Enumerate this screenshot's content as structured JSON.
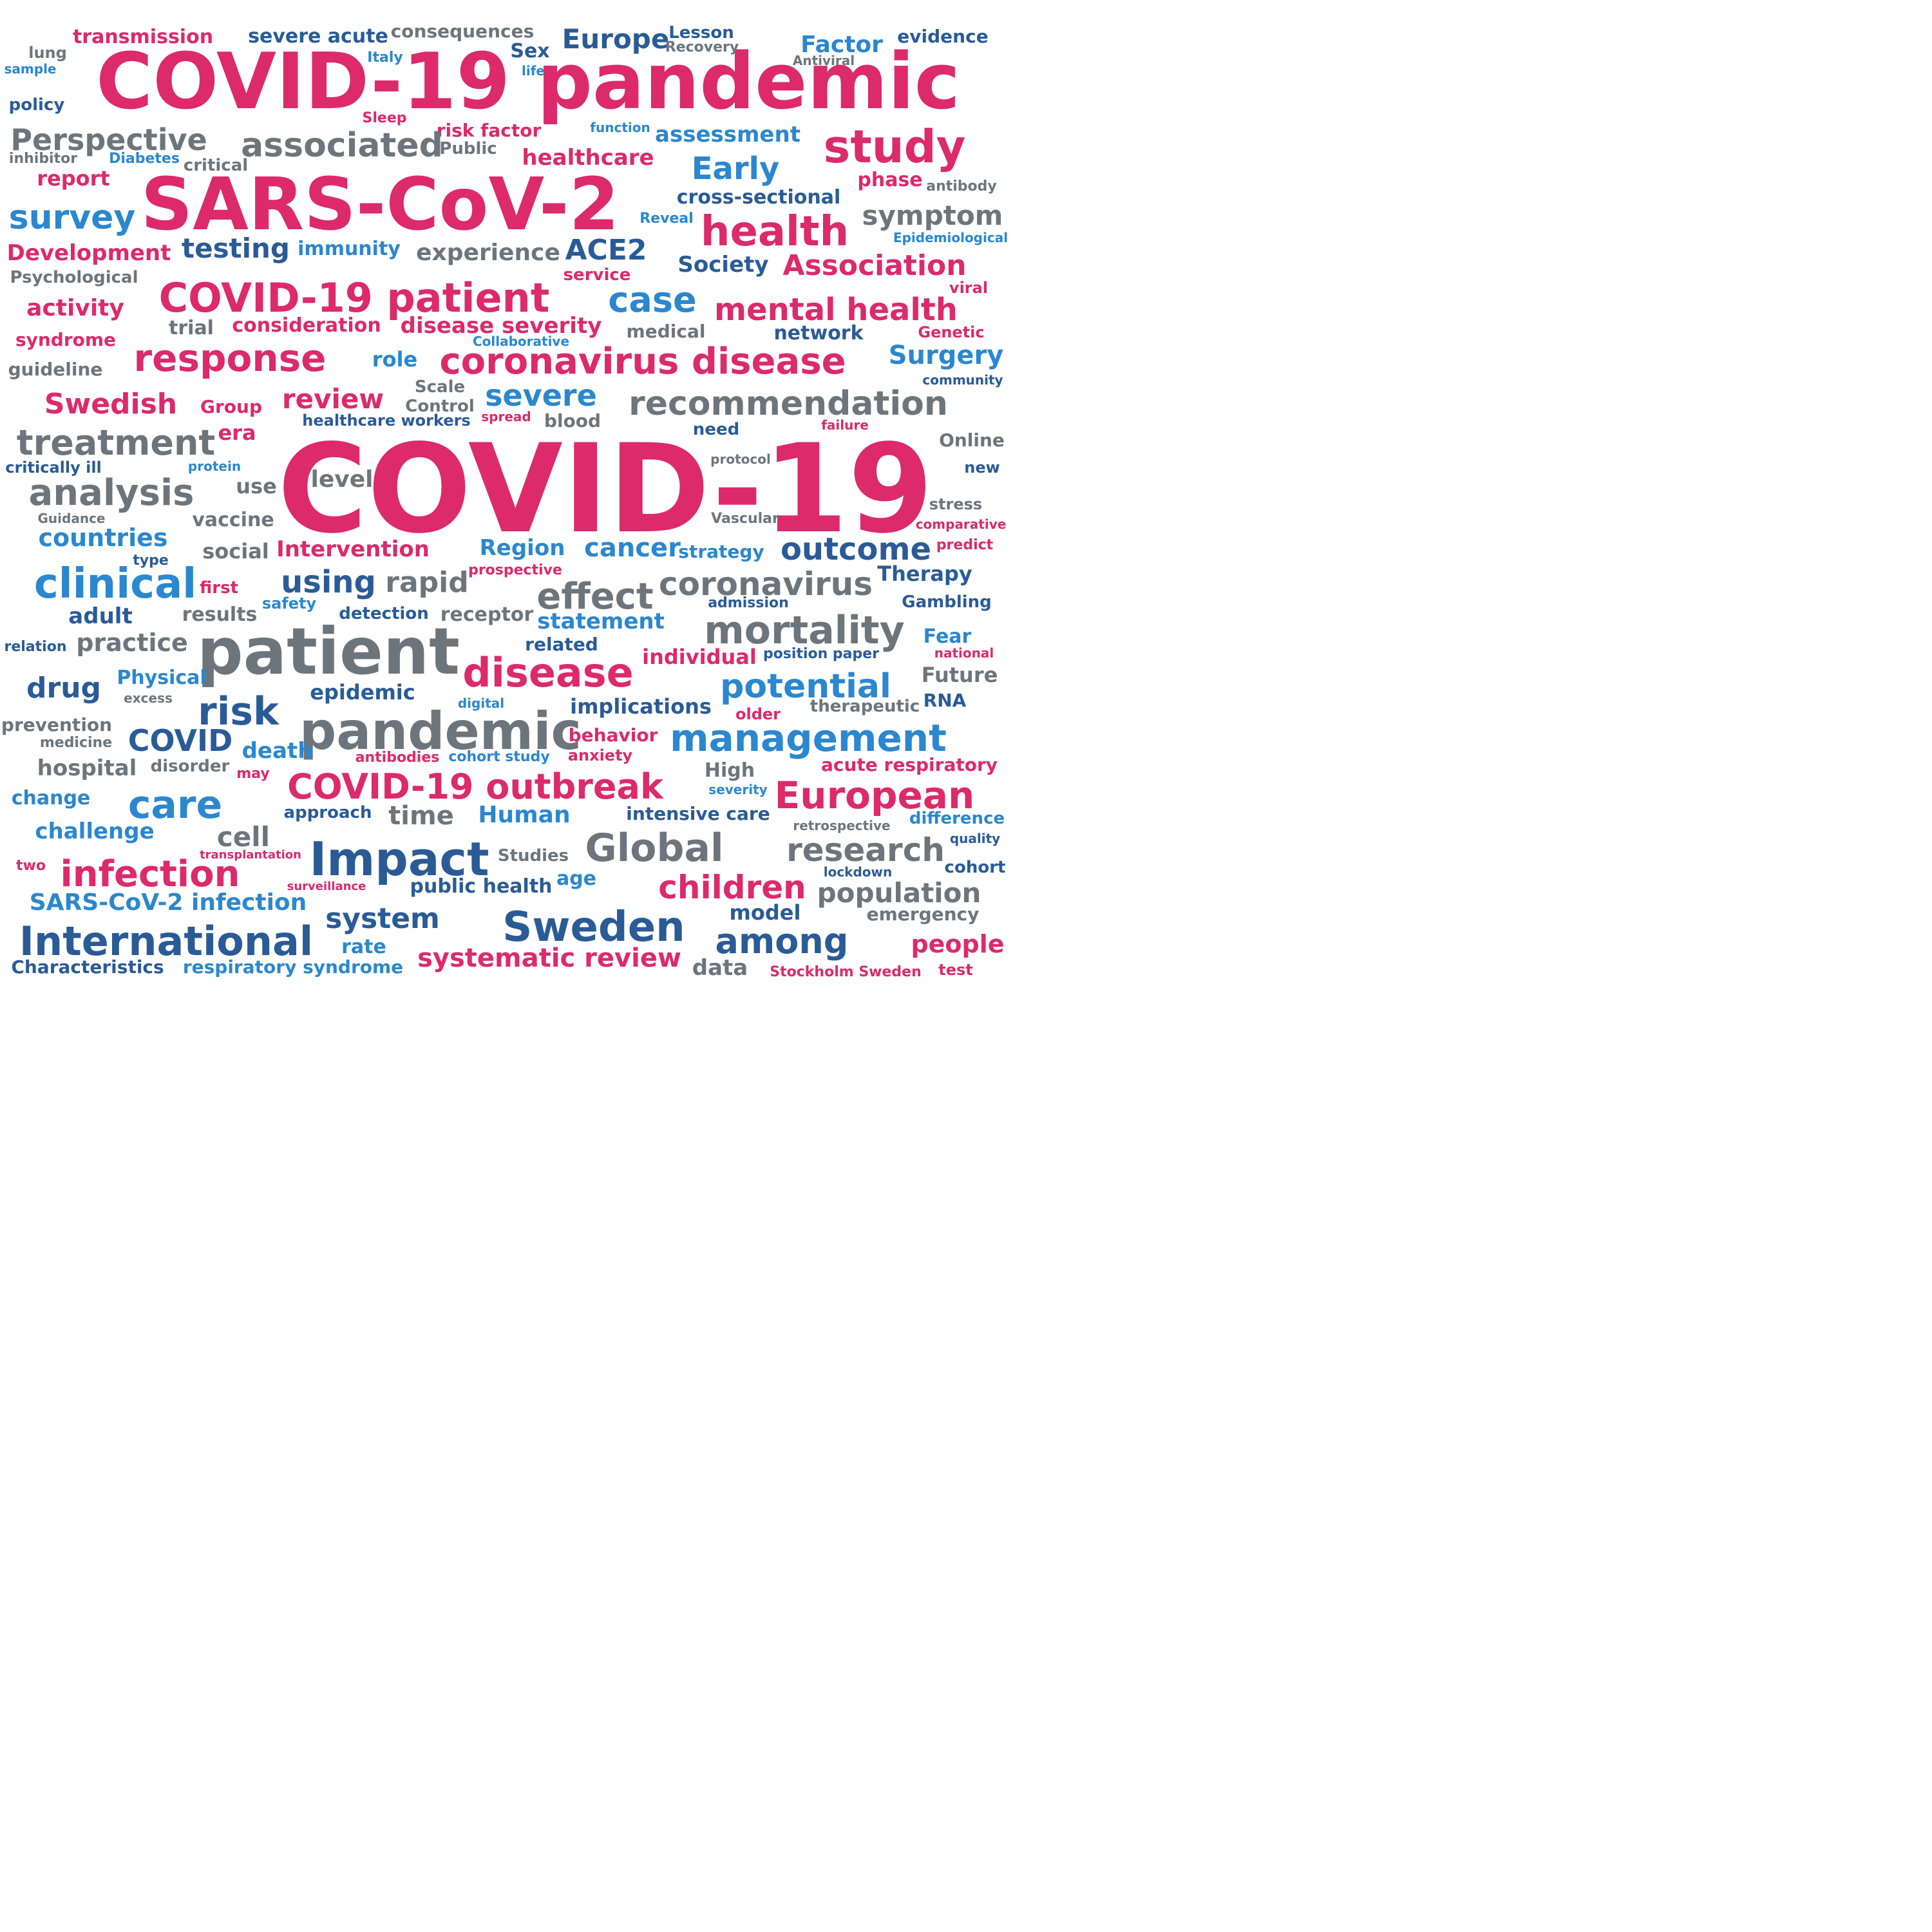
{
  "colors": {
    "pink": "#dc2a6b",
    "blue": "#2b87cf",
    "navy": "#2a5b97",
    "gray": "#6d757c"
  },
  "words": [
    {
      "text": "COVID-19 pandemic",
      "color": "pink"
    },
    {
      "text": "COVID-19",
      "color": "pink"
    },
    {
      "text": "SARS-CoV-2",
      "color": "pink"
    },
    {
      "text": "transmission",
      "color": "pink"
    },
    {
      "text": "severe acute",
      "color": "navy"
    },
    {
      "text": "consequences",
      "color": "gray"
    },
    {
      "text": "Europe",
      "color": "navy"
    },
    {
      "text": "Lesson",
      "color": "navy"
    },
    {
      "text": "Recovery",
      "color": "gray"
    },
    {
      "text": "Factor",
      "color": "blue"
    },
    {
      "text": "evidence",
      "color": "navy"
    },
    {
      "text": "lung",
      "color": "gray"
    },
    {
      "text": "sample",
      "color": "blue"
    },
    {
      "text": "Italy",
      "color": "blue"
    },
    {
      "text": "Sex",
      "color": "navy"
    },
    {
      "text": "life",
      "color": "blue"
    },
    {
      "text": "Antiviral",
      "color": "gray"
    },
    {
      "text": "policy",
      "color": "navy"
    },
    {
      "text": "Sleep",
      "color": "pink"
    },
    {
      "text": "risk factor",
      "color": "pink"
    },
    {
      "text": "function",
      "color": "blue"
    },
    {
      "text": "Perspective",
      "color": "gray"
    },
    {
      "text": "associated",
      "color": "gray"
    },
    {
      "text": "assessment",
      "color": "blue"
    },
    {
      "text": "study",
      "color": "pink"
    },
    {
      "text": "inhibitor",
      "color": "gray"
    },
    {
      "text": "Diabetes",
      "color": "blue"
    },
    {
      "text": "critical",
      "color": "gray"
    },
    {
      "text": "Public",
      "color": "gray"
    },
    {
      "text": "healthcare",
      "color": "pink"
    },
    {
      "text": "Early",
      "color": "blue"
    },
    {
      "text": "report",
      "color": "pink"
    },
    {
      "text": "phase",
      "color": "pink"
    },
    {
      "text": "antibody",
      "color": "gray"
    },
    {
      "text": "cross-sectional",
      "color": "navy"
    },
    {
      "text": "survey",
      "color": "blue"
    },
    {
      "text": "Reveal",
      "color": "blue"
    },
    {
      "text": "symptom",
      "color": "gray"
    },
    {
      "text": "health",
      "color": "pink"
    },
    {
      "text": "Epidemiological",
      "color": "blue"
    },
    {
      "text": "Development",
      "color": "pink"
    },
    {
      "text": "testing",
      "color": "navy"
    },
    {
      "text": "immunity",
      "color": "blue"
    },
    {
      "text": "experience",
      "color": "gray"
    },
    {
      "text": "ACE2",
      "color": "navy"
    },
    {
      "text": "Society",
      "color": "navy"
    },
    {
      "text": "Association",
      "color": "pink"
    },
    {
      "text": "Psychological",
      "color": "gray"
    },
    {
      "text": "service",
      "color": "pink"
    },
    {
      "text": "viral",
      "color": "pink"
    },
    {
      "text": "activity",
      "color": "pink"
    },
    {
      "text": "COVID-19 patient",
      "color": "pink"
    },
    {
      "text": "case",
      "color": "blue"
    },
    {
      "text": "mental health",
      "color": "pink"
    },
    {
      "text": "trial",
      "color": "gray"
    },
    {
      "text": "consideration",
      "color": "pink"
    },
    {
      "text": "disease severity",
      "color": "pink"
    },
    {
      "text": "medical",
      "color": "gray"
    },
    {
      "text": "network",
      "color": "navy"
    },
    {
      "text": "Genetic",
      "color": "pink"
    },
    {
      "text": "syndrome",
      "color": "pink"
    },
    {
      "text": "Collaborative",
      "color": "blue"
    },
    {
      "text": "response",
      "color": "pink"
    },
    {
      "text": "role",
      "color": "blue"
    },
    {
      "text": "coronavirus disease",
      "color": "pink"
    },
    {
      "text": "Surgery",
      "color": "blue"
    },
    {
      "text": "guideline",
      "color": "gray"
    },
    {
      "text": "community",
      "color": "navy"
    },
    {
      "text": "Scale",
      "color": "gray"
    },
    {
      "text": "Swedish",
      "color": "pink"
    },
    {
      "text": "Group",
      "color": "pink"
    },
    {
      "text": "review",
      "color": "pink"
    },
    {
      "text": "Control",
      "color": "gray"
    },
    {
      "text": "severe",
      "color": "blue"
    },
    {
      "text": "recommendation",
      "color": "gray"
    },
    {
      "text": "healthcare workers",
      "color": "navy"
    },
    {
      "text": "spread",
      "color": "pink"
    },
    {
      "text": "blood",
      "color": "gray"
    },
    {
      "text": "need",
      "color": "navy"
    },
    {
      "text": "failure",
      "color": "pink"
    },
    {
      "text": "treatment",
      "color": "gray"
    },
    {
      "text": "era",
      "color": "pink"
    },
    {
      "text": "Online",
      "color": "gray"
    },
    {
      "text": "critically ill",
      "color": "navy"
    },
    {
      "text": "protein",
      "color": "blue"
    },
    {
      "text": "protocol",
      "color": "gray"
    },
    {
      "text": "new",
      "color": "navy"
    },
    {
      "text": "analysis",
      "color": "gray"
    },
    {
      "text": "use",
      "color": "gray"
    },
    {
      "text": "level",
      "color": "gray"
    },
    {
      "text": "stress",
      "color": "gray"
    },
    {
      "text": "Guidance",
      "color": "gray"
    },
    {
      "text": "vaccine",
      "color": "gray"
    },
    {
      "text": "Vascular",
      "color": "gray"
    },
    {
      "text": "comparative",
      "color": "pink"
    },
    {
      "text": "countries",
      "color": "blue"
    },
    {
      "text": "social",
      "color": "gray"
    },
    {
      "text": "Intervention",
      "color": "pink"
    },
    {
      "text": "Region",
      "color": "blue"
    },
    {
      "text": "cancer",
      "color": "blue"
    },
    {
      "text": "strategy",
      "color": "blue"
    },
    {
      "text": "outcome",
      "color": "navy"
    },
    {
      "text": "predict",
      "color": "pink"
    },
    {
      "text": "type",
      "color": "navy"
    },
    {
      "text": "clinical",
      "color": "blue"
    },
    {
      "text": "prospective",
      "color": "pink"
    },
    {
      "text": "Therapy",
      "color": "navy"
    },
    {
      "text": "first",
      "color": "pink"
    },
    {
      "text": "using",
      "color": "navy"
    },
    {
      "text": "rapid",
      "color": "gray"
    },
    {
      "text": "effect",
      "color": "gray"
    },
    {
      "text": "coronavirus",
      "color": "gray"
    },
    {
      "text": "safety",
      "color": "blue"
    },
    {
      "text": "admission",
      "color": "navy"
    },
    {
      "text": "Gambling",
      "color": "navy"
    },
    {
      "text": "adult",
      "color": "navy"
    },
    {
      "text": "results",
      "color": "gray"
    },
    {
      "text": "detection",
      "color": "navy"
    },
    {
      "text": "receptor",
      "color": "gray"
    },
    {
      "text": "statement",
      "color": "blue"
    },
    {
      "text": "mortality",
      "color": "gray"
    },
    {
      "text": "relation",
      "color": "navy"
    },
    {
      "text": "practice",
      "color": "gray"
    },
    {
      "text": "patient",
      "color": "gray"
    },
    {
      "text": "related",
      "color": "navy"
    },
    {
      "text": "Fear",
      "color": "blue"
    },
    {
      "text": "individual",
      "color": "pink"
    },
    {
      "text": "position paper",
      "color": "navy"
    },
    {
      "text": "national",
      "color": "pink"
    },
    {
      "text": "disease",
      "color": "pink"
    },
    {
      "text": "drug",
      "color": "navy"
    },
    {
      "text": "Physical",
      "color": "blue"
    },
    {
      "text": "potential",
      "color": "blue"
    },
    {
      "text": "Future",
      "color": "gray"
    },
    {
      "text": "excess",
      "color": "gray"
    },
    {
      "text": "epidemic",
      "color": "navy"
    },
    {
      "text": "digital",
      "color": "blue"
    },
    {
      "text": "implications",
      "color": "navy"
    },
    {
      "text": "therapeutic",
      "color": "gray"
    },
    {
      "text": "RNA",
      "color": "navy"
    },
    {
      "text": "risk",
      "color": "navy"
    },
    {
      "text": "older",
      "color": "pink"
    },
    {
      "text": "prevention",
      "color": "gray"
    },
    {
      "text": "medicine",
      "color": "gray"
    },
    {
      "text": "COVID",
      "color": "navy"
    },
    {
      "text": "pandemic",
      "color": "gray"
    },
    {
      "text": "behavior",
      "color": "pink"
    },
    {
      "text": "management",
      "color": "blue"
    },
    {
      "text": "death",
      "color": "blue"
    },
    {
      "text": "antibodies",
      "color": "pink"
    },
    {
      "text": "cohort study",
      "color": "blue"
    },
    {
      "text": "anxiety",
      "color": "pink"
    },
    {
      "text": "hospital",
      "color": "gray"
    },
    {
      "text": "disorder",
      "color": "gray"
    },
    {
      "text": "High",
      "color": "gray"
    },
    {
      "text": "acute respiratory",
      "color": "pink"
    },
    {
      "text": "may",
      "color": "pink"
    },
    {
      "text": "COVID-19 outbreak",
      "color": "pink"
    },
    {
      "text": "severity",
      "color": "blue"
    },
    {
      "text": "European",
      "color": "pink"
    },
    {
      "text": "change",
      "color": "blue"
    },
    {
      "text": "care",
      "color": "blue"
    },
    {
      "text": "approach",
      "color": "navy"
    },
    {
      "text": "time",
      "color": "gray"
    },
    {
      "text": "Human",
      "color": "blue"
    },
    {
      "text": "intensive care",
      "color": "navy"
    },
    {
      "text": "retrospective",
      "color": "gray"
    },
    {
      "text": "difference",
      "color": "blue"
    },
    {
      "text": "challenge",
      "color": "blue"
    },
    {
      "text": "cell",
      "color": "gray"
    },
    {
      "text": "Global",
      "color": "gray"
    },
    {
      "text": "quality",
      "color": "navy"
    },
    {
      "text": "Impact",
      "color": "navy"
    },
    {
      "text": "Studies",
      "color": "gray"
    },
    {
      "text": "research",
      "color": "gray"
    },
    {
      "text": "transplantation",
      "color": "pink"
    },
    {
      "text": "two",
      "color": "pink"
    },
    {
      "text": "infection",
      "color": "pink"
    },
    {
      "text": "cohort",
      "color": "navy"
    },
    {
      "text": "lockdown",
      "color": "navy"
    },
    {
      "text": "age",
      "color": "blue"
    },
    {
      "text": "surveillance",
      "color": "pink"
    },
    {
      "text": "public health",
      "color": "navy"
    },
    {
      "text": "children",
      "color": "pink"
    },
    {
      "text": "population",
      "color": "gray"
    },
    {
      "text": "SARS-CoV-2 infection",
      "color": "blue"
    },
    {
      "text": "model",
      "color": "navy"
    },
    {
      "text": "emergency",
      "color": "gray"
    },
    {
      "text": "system",
      "color": "navy"
    },
    {
      "text": "Sweden",
      "color": "navy"
    },
    {
      "text": "International",
      "color": "navy"
    },
    {
      "text": "among",
      "color": "navy"
    },
    {
      "text": "people",
      "color": "pink"
    },
    {
      "text": "rate",
      "color": "blue"
    },
    {
      "text": "systematic review",
      "color": "pink"
    },
    {
      "text": "Characteristics",
      "color": "navy"
    },
    {
      "text": "respiratory syndrome",
      "color": "blue"
    },
    {
      "text": "data",
      "color": "gray"
    },
    {
      "text": "Stockholm Sweden",
      "color": "pink"
    },
    {
      "text": "test",
      "color": "pink"
    }
  ]
}
